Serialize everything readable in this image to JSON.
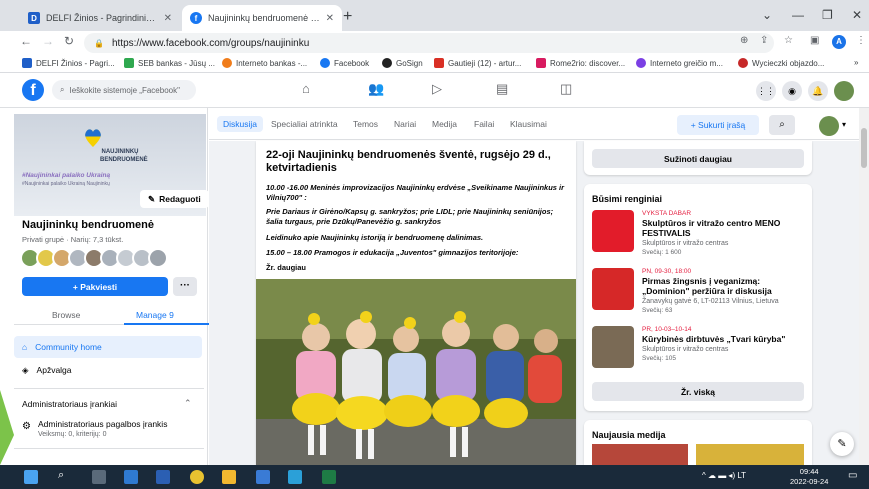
{
  "browser": {
    "tabs": [
      {
        "title": "DELFI Žinios - Pagrindinis naujien",
        "favicon": "D",
        "active": false
      },
      {
        "title": "Naujininkų bendruomenė | Facebo",
        "favicon": "f",
        "active": true
      }
    ],
    "url": "https://www.facebook.com/groups/naujininku",
    "avatar_letter": "A",
    "bookmarks": [
      {
        "label": "DELFI Žinios - Pagri...",
        "color": "#1f5fc8"
      },
      {
        "label": "SEB bankas - Jūsų ...",
        "color": "#2fa84f"
      },
      {
        "label": "Interneto bankas -...",
        "color": "#f07c1a"
      },
      {
        "label": "Facebook",
        "color": "#1877f2"
      },
      {
        "label": "GoSign",
        "color": "#222222"
      },
      {
        "label": "Gautieji (12) - artur...",
        "color": "#d93025"
      },
      {
        "label": "Rome2rio: discover...",
        "color": "#d81b60"
      },
      {
        "label": "Interneto greičio m...",
        "color": "#7b3fe4"
      },
      {
        "label": "Wycieczki objazdo...",
        "color": "#c62828"
      }
    ]
  },
  "fb": {
    "search_placeholder": "Ieškokite sistemoje „Facebook\""
  },
  "group": {
    "cover_title": "NAUJININKŲ BENDRUOMENĖ",
    "cover_slogan": "#Naujininkai palaiko Ukrainą",
    "cover_slogan_small": "#Naujininkai palaiko Ukrainą Naujininkų",
    "edit_cover": "Redaguoti",
    "name": "Naujininkų bendruomenė",
    "meta": "Privati grupė · Narių: 7,3 tūkst.",
    "invite": "+ Pakviesti",
    "more": "···",
    "tab_browse": "Browse",
    "tab_manage": "Manage",
    "manage_count": "9",
    "nav": [
      {
        "label": "Community home"
      },
      {
        "label": "Apžvalga"
      }
    ],
    "admin_section": "Administratoriaus įrankiai",
    "admin_tool_title": "Administratoriaus pagalbos įrankis",
    "admin_tool_sub": "Veiksmų: 0, kriterijų: 0",
    "tabs": [
      "Diskusija",
      "Specialiai atrinkta",
      "Temos",
      "Nariai",
      "Medija",
      "Failai",
      "Klausimai"
    ],
    "create_post": "+ Sukurti įrašą"
  },
  "post": {
    "title": "22-oji Naujininkų bendruomenės šventė, rugsėjo 29 d., ketvirtadienis",
    "line1": "10.00 -16.00 Meninės improvizacijos Naujininkų erdvėse „Sveikiname Naujininkus ir Vilnių700\" :",
    "line2": "Prie Dariaus ir Girėno/Kapsų g. sankryžos; prie LIDL; prie Naujininkų seniūnijos; šalia turgaus, prie Dzūkų/Panevėžio g. sankryžos",
    "line3": "Leidinuko apie Naujininkų istoriją ir bendruomenę dalinimas.",
    "line4": "15.00 – 18.00 Pramogos ir edukacija „Juventos\" gimnazijos teritorijoje:",
    "see_more": "Žr. daugiau"
  },
  "right": {
    "learn_more": "Sužinoti daugiau",
    "events_title": "Būsimi renginiai",
    "events": [
      {
        "date": "VYKSTA DABAR",
        "name": "Skulptūros ir vitražo centro MENO FESTIVALIS",
        "location": "Skulptūros ir vitražo centras",
        "guests": "Svečių: 1 600",
        "thumb_color": "#e21c2a"
      },
      {
        "date": "PN, 09-30, 18:00",
        "name": "Pirmas žingsnis į veganizmą: „Dominion\" peržiūra ir diskusija",
        "location": "Žanavykų gatvė 6, LT-02113 Vilnius, Lietuva",
        "guests": "Svečių: 63",
        "thumb_color": "#d62828"
      },
      {
        "date": "PR, 10-03–10-14",
        "name": "Kūrybinės dirbtuvės „Tvari kūryba\"",
        "location": "Skulptūros ir vitražo centras",
        "guests": "Svečių: 105",
        "thumb_color": "#7a6a55"
      }
    ],
    "see_all": "Žr. viską",
    "media_title": "Naujausia medija"
  },
  "taskbar": {
    "time": "09:44",
    "date": "2022-09-24",
    "lang": "LT"
  }
}
